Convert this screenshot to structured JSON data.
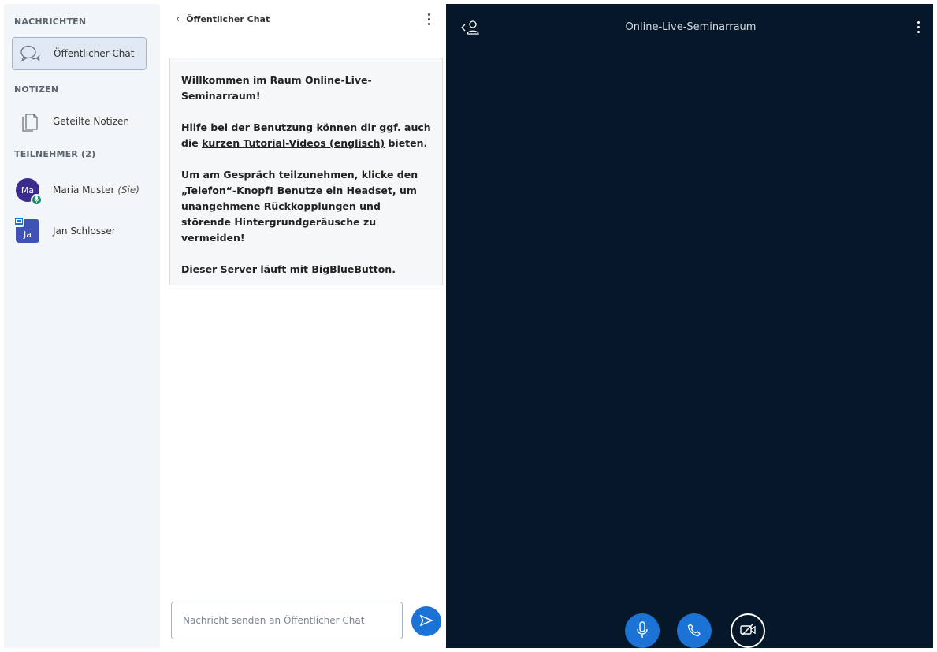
{
  "sidebar": {
    "messages_title": "NACHRICHTEN",
    "public_chat_label": "Öffentlicher Chat",
    "notes_title": "NOTIZEN",
    "shared_notes_label": "Geteilte Notizen",
    "participants_title": "TEILNEHMER (2)",
    "users": [
      {
        "initials": "Ma",
        "name": "Maria Muster",
        "suffix": "(Sie)"
      },
      {
        "initials": "Ja",
        "name": "Jan Schlosser"
      }
    ]
  },
  "chat": {
    "header_title": "Öffentlicher Chat",
    "welcome": {
      "line1_prefix": "Willkommen im Raum ",
      "line1_room": "Online-Live-Seminarraum",
      "line1_suffix": "!",
      "help_prefix": "Hilfe bei der Benutzung können dir ggf. auch die ",
      "help_link": "kurzen Tutorial-Videos (englisch)",
      "help_suffix": " bieten.",
      "join_text": "Um am Gespräch teilzunehmen, klicke den „Telefon“-Knopf! Benutze ein Headset, um unangehmene Rückkopplungen und störende Hintergrundgeräusche zu vermeiden!",
      "server_prefix": "Dieser Server läuft mit ",
      "server_link": "BigBlueButton",
      "server_suffix": "."
    },
    "input_placeholder": "Nachricht senden an Öffentlicher Chat"
  },
  "stage": {
    "title": "Online-Live-Seminarraum"
  },
  "colors": {
    "accent": "#1b73d6",
    "stage_bg": "#06172a",
    "sidebar_bg": "#f3f6f9"
  }
}
